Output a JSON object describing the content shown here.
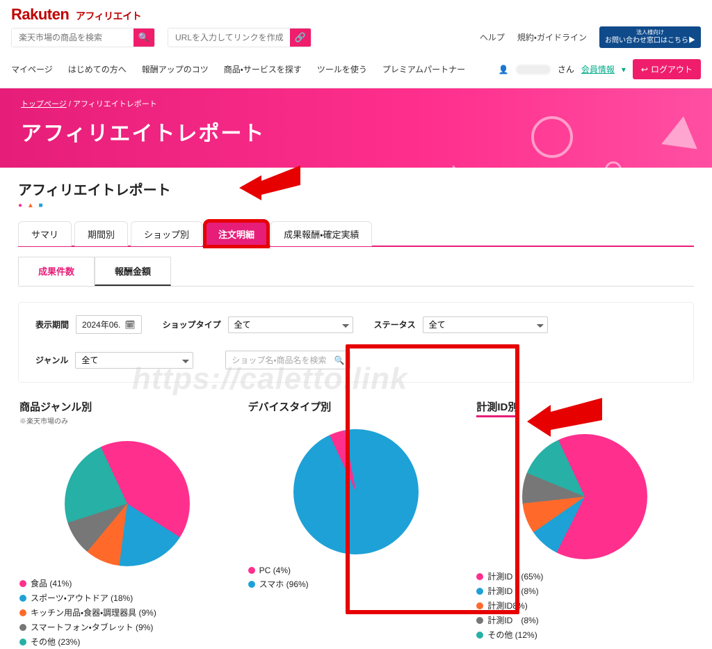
{
  "brand": {
    "name": "Rakuten",
    "sub": "アフィリエイト"
  },
  "search": {
    "product_placeholder": "楽天市場の商品を検索",
    "url_placeholder": "URLを入力してリンクを作成"
  },
  "toplinks": {
    "help": "ヘルプ",
    "terms": "規約・ガイドライン"
  },
  "contact": {
    "small": "法人様向け",
    "label": "お問い合わせ窓口はこちら▶"
  },
  "nav": {
    "mypage": "マイページ",
    "beginners": "はじめての方へ",
    "tips": "報酬アップのコツ",
    "products": "商品・サービスを探す",
    "tools": "ツールを使う",
    "premium": "プレミアムパートナー"
  },
  "userbox": {
    "san": "さん",
    "member": "会員情報",
    "logout": "ログアウト"
  },
  "breadcrumb": {
    "top": "トップページ",
    "here": "アフィリエイトレポート"
  },
  "hero_title": "アフィリエイトレポート",
  "section_title": "アフィリエイトレポート",
  "tabs": {
    "summary": "サマリ",
    "period": "期間別",
    "shop": "ショップ別",
    "orders": "注文明細",
    "results": "成果報酬・確定実績"
  },
  "subtabs": {
    "count": "成果件数",
    "amount": "報酬金額"
  },
  "filters": {
    "period_label": "表示期間",
    "period_value": "2024年06.",
    "shoptype_label": "ショップタイプ",
    "shoptype_value": "全て",
    "status_label": "ステータス",
    "status_value": "全て",
    "genre_label": "ジャンル",
    "genre_value": "全て",
    "search_placeholder": "ショップ名・商品名を検索"
  },
  "charts": {
    "genre_title": "商品ジャンル別",
    "genre_note": "※楽天市場のみ",
    "device_title": "デバイスタイプ別",
    "measure_title": "計測ID別"
  },
  "chart_data": [
    {
      "type": "pie",
      "title": "商品ジャンル別",
      "series": [
        {
          "name": "食品",
          "value": 41,
          "color": "#ff2f8d"
        },
        {
          "name": "スポーツ・アウトドア",
          "value": 18,
          "color": "#1ea1d6"
        },
        {
          "name": "キッチン用品・食器・調理器具",
          "value": 9,
          "color": "#ff6a2b"
        },
        {
          "name": "スマートフォン・タブレット",
          "value": 9,
          "color": "#777"
        },
        {
          "name": "その他",
          "value": 23,
          "color": "#26b0a6"
        }
      ],
      "legend": [
        "食品 (41%)",
        "スポーツ・アウトドア (18%)",
        "キッチン用品・食器・調理器具 (9%)",
        "スマートフォン・タブレット (9%)",
        "その他 (23%)"
      ]
    },
    {
      "type": "pie",
      "title": "デバイスタイプ別",
      "series": [
        {
          "name": "PC",
          "value": 4,
          "color": "#ff2f8d"
        },
        {
          "name": "スマホ",
          "value": 96,
          "color": "#1ea1d6"
        }
      ],
      "legend": [
        "PC (4%)",
        "スマホ (96%)"
      ]
    },
    {
      "type": "pie",
      "title": "計測ID別",
      "series": [
        {
          "name": "計測ID",
          "value": 65,
          "color": "#ff2f8d",
          "label": "計測ID　(65%)"
        },
        {
          "name": "計測ID",
          "value": 8,
          "color": "#1ea1d6",
          "label": "計測ID　(8%)"
        },
        {
          "name": "計測ID",
          "value": 8,
          "color": "#ff6a2b",
          "label": "計測ID8%)"
        },
        {
          "name": "計測ID",
          "value": 8,
          "color": "#777",
          "label": "計測ID　(8%)"
        },
        {
          "name": "その他",
          "value": 12,
          "color": "#26b0a6",
          "label": "その他 (12%)"
        }
      ],
      "legend": [
        "計測ID　(65%)",
        "計測ID　(8%)",
        "計測ID8%)",
        "計測ID　(8%)",
        "その他 (12%)"
      ]
    }
  ],
  "watermark": "https://caletto.link"
}
